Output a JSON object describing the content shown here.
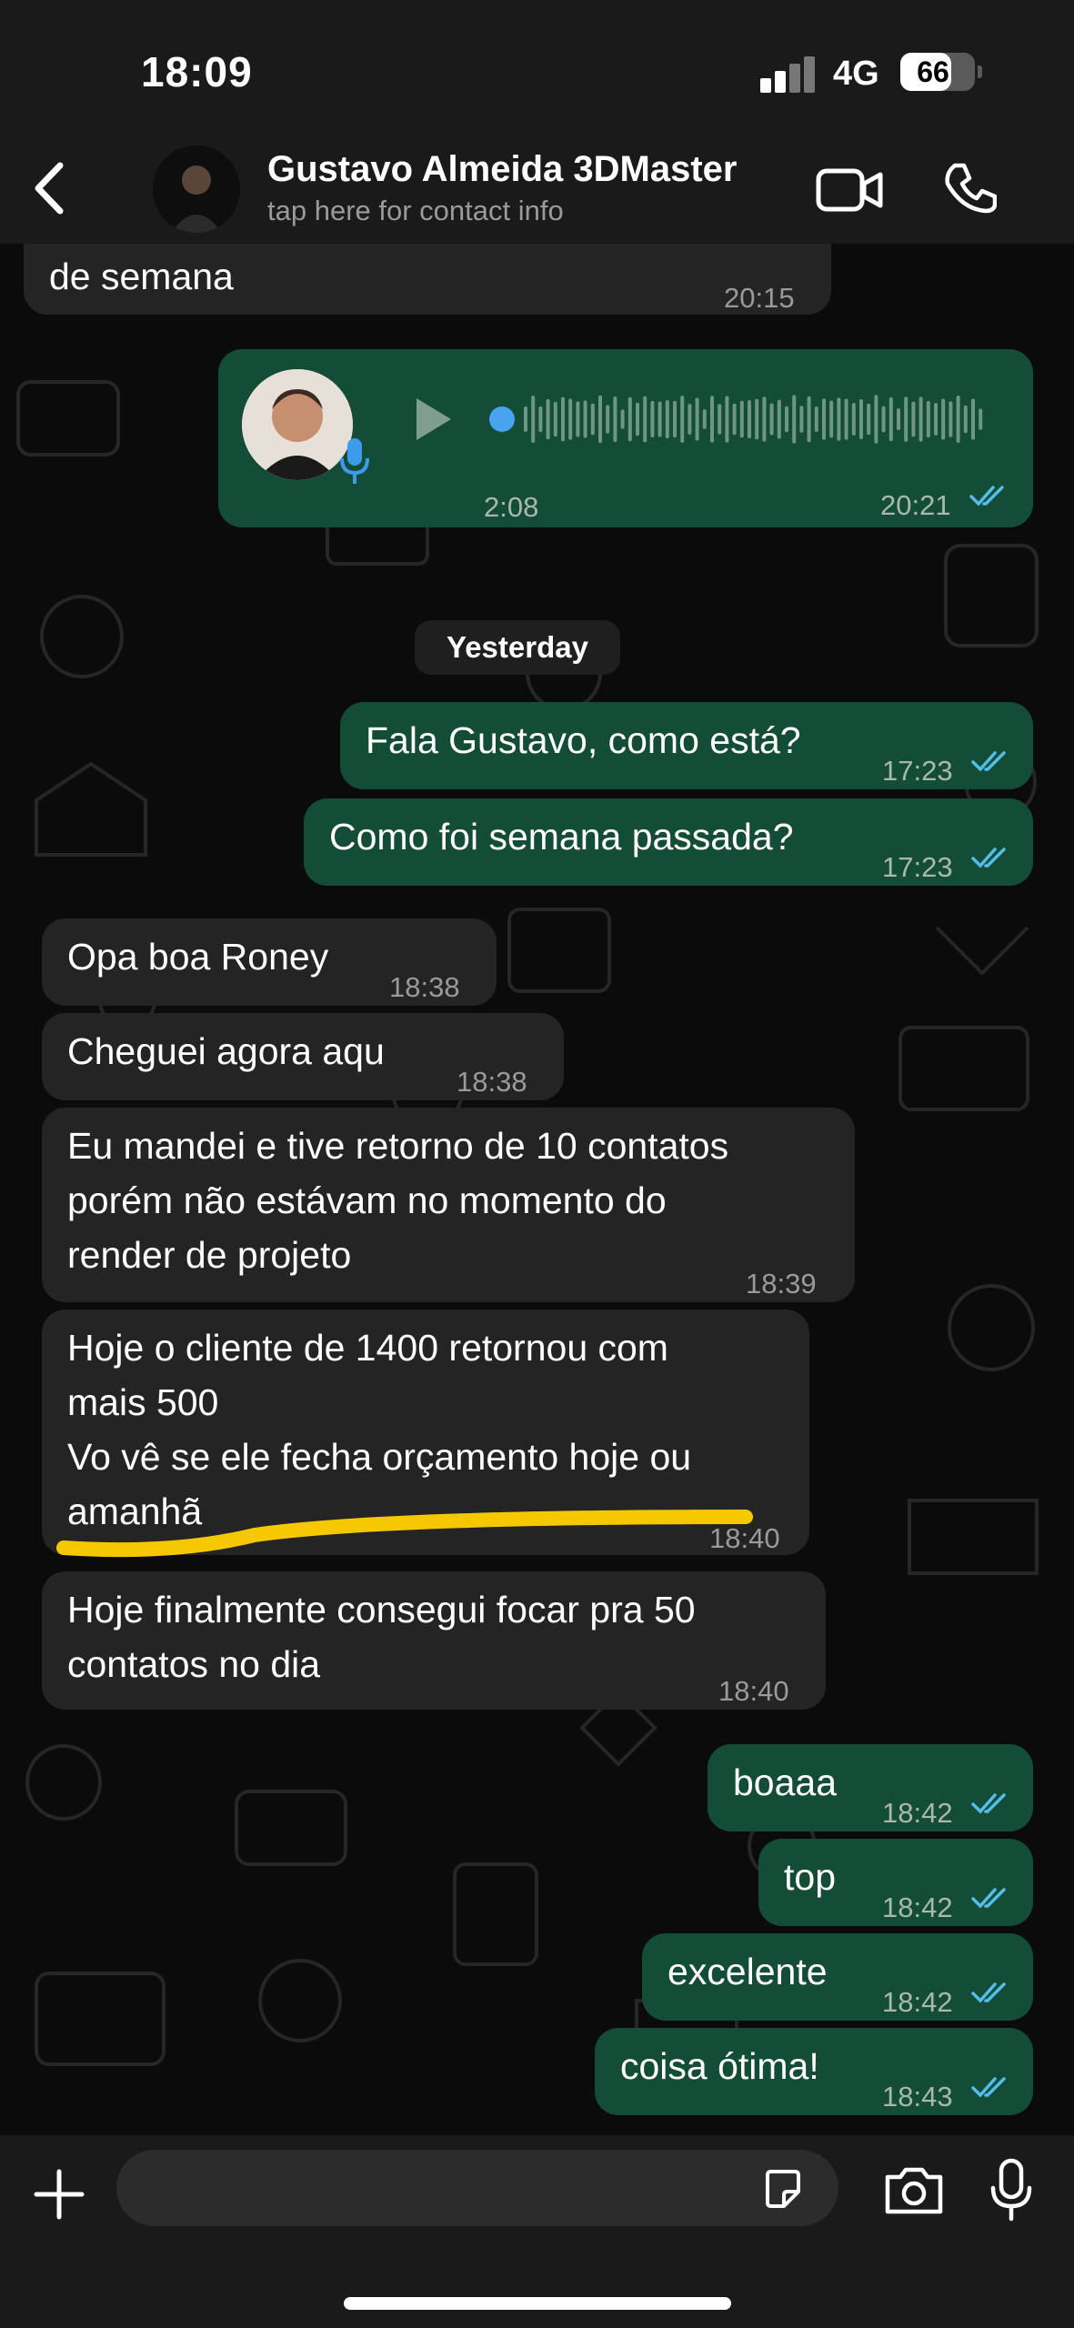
{
  "status_bar": {
    "time": "18:09",
    "network": "4G",
    "battery": "66"
  },
  "header": {
    "name": "Gustavo Almeida 3DMaster",
    "subtitle": "tap here for contact info"
  },
  "messages": [
    {
      "dir": "in",
      "text": "de semana",
      "time": "20:15"
    },
    {
      "dir": "out",
      "type": "voice",
      "duration": "2:08",
      "time": "20:21"
    },
    {
      "dir": "out",
      "text": "Fala Gustavo, como está?",
      "time": "17:23"
    },
    {
      "dir": "out",
      "text": "Como foi semana passada?",
      "time": "17:23"
    },
    {
      "dir": "in",
      "text": "Opa boa Roney",
      "time": "18:38"
    },
    {
      "dir": "in",
      "text": "Cheguei agora aqu",
      "time": "18:38"
    },
    {
      "dir": "in",
      "text": "Eu mandei e tive retorno de 10 contatos\nporém não estávam no momento do\nrender de projeto",
      "time": "18:39"
    },
    {
      "dir": "in",
      "text": "Hoje o cliente de 1400 retornou com\nmais 500\nVo vê se ele fecha orçamento hoje ou\namanhã",
      "time": "18:40"
    },
    {
      "dir": "in",
      "text": "Hoje finalmente consegui focar pra 50\ncontatos no dia",
      "time": "18:40"
    },
    {
      "dir": "out",
      "text": "boaaa",
      "time": "18:42"
    },
    {
      "dir": "out",
      "text": "top",
      "time": "18:42"
    },
    {
      "dir": "out",
      "text": "excelente",
      "time": "18:42"
    },
    {
      "dir": "out",
      "text": "coisa ótima!",
      "time": "18:43"
    }
  ],
  "day_separator": "Yesterday",
  "colors": {
    "incoming": "#242424",
    "outgoing": "#144d37",
    "read_ticks": "#53bdeb",
    "highlight": "#f5c800"
  },
  "icons": [
    "back-chevron-icon",
    "video-call-icon",
    "phone-icon",
    "play-icon",
    "mic-icon",
    "plus-icon",
    "sticker-icon",
    "camera-icon",
    "voice-mic-icon"
  ]
}
